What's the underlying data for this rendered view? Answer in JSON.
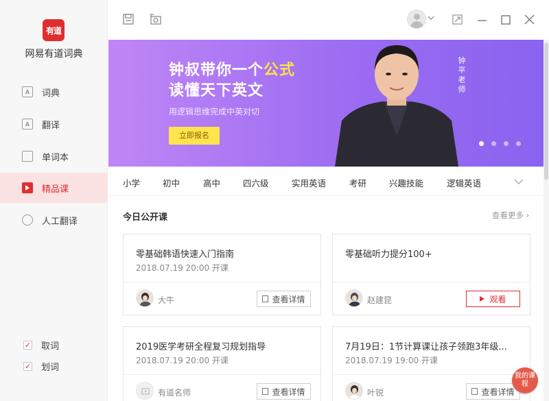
{
  "app": {
    "logo_text": "有道",
    "name": "网易有道词典"
  },
  "sidebar": {
    "items": [
      {
        "label": "词典",
        "icon": "dictionary-icon",
        "glyph": "A"
      },
      {
        "label": "翻译",
        "icon": "translate-icon",
        "glyph": "A"
      },
      {
        "label": "单词本",
        "icon": "wordbook-icon",
        "glyph": ""
      },
      {
        "label": "精品课",
        "icon": "course-icon",
        "glyph": ""
      },
      {
        "label": "人工翻译",
        "icon": "human-translate-icon",
        "glyph": ""
      }
    ],
    "active_index": 3,
    "checkboxes": [
      {
        "label": "取词",
        "checked": true
      },
      {
        "label": "划词",
        "checked": true
      }
    ]
  },
  "banner": {
    "line1_pre": "钟叔带你一个",
    "line1_hl": "公式",
    "line2": "读懂天下英文",
    "subtitle": "用逻辑思维完成中英对切",
    "button": "立即报名",
    "teacher_vertical": "钟平老师",
    "slides": 4,
    "active_slide": 0,
    "highlight_color": "#ffe14a"
  },
  "categories": [
    "小学",
    "初中",
    "高中",
    "四六级",
    "实用英语",
    "考研",
    "兴趣技能",
    "逻辑英语"
  ],
  "section": {
    "title": "今日公开课",
    "more": "查看更多"
  },
  "courses": [
    {
      "title": "零基础韩语快速入门指南",
      "time": "2018.07.19 20:00 开课",
      "teacher": "大牛",
      "action": "查看详情",
      "type": "detail"
    },
    {
      "title": "零基础听力提分100+",
      "time": "",
      "teacher": "赵建昆",
      "action": "观看",
      "type": "watch"
    },
    {
      "title": "2019医学考研全程复习规划指导",
      "time": "2018.07.19 20:00 开课",
      "teacher": "有道名师",
      "action": "查看详情",
      "type": "detail"
    },
    {
      "title": "7月19日：1节计算课让孩子领跑3年级...",
      "time": "2018.07.19 19:00 开课",
      "teacher": "叶锐",
      "action": "查看详情",
      "type": "detail"
    }
  ],
  "my_course": "我的课程",
  "colors": {
    "accent": "#e02d2d",
    "banner_start": "#bf86f5",
    "banner_end": "#8a63ef"
  }
}
